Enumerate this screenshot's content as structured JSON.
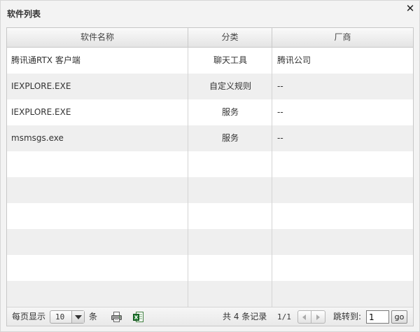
{
  "dialog": {
    "title": "软件列表",
    "close_symbol": "✕"
  },
  "table": {
    "columns": [
      "软件名称",
      "分类",
      "厂商"
    ],
    "rows": [
      {
        "name": "腾讯通RTX 客户端",
        "category": "聊天工具",
        "vendor": "腾讯公司"
      },
      {
        "name": "IEXPLORE.EXE",
        "category": "自定义规则",
        "vendor": "--"
      },
      {
        "name": "IEXPLORE.EXE",
        "category": "服务",
        "vendor": "--"
      },
      {
        "name": "msmsgs.exe",
        "category": "服务",
        "vendor": "--"
      }
    ]
  },
  "pager": {
    "per_page_label": "每页显示",
    "per_page_value": "10",
    "unit_label": "条",
    "total_text": "共 4 条记录",
    "page_indicator": "1/1",
    "jump_label": "跳转到:",
    "jump_value": "1",
    "go_label": "go"
  },
  "icons": {
    "print": "print-icon",
    "excel": "excel-export-icon"
  }
}
